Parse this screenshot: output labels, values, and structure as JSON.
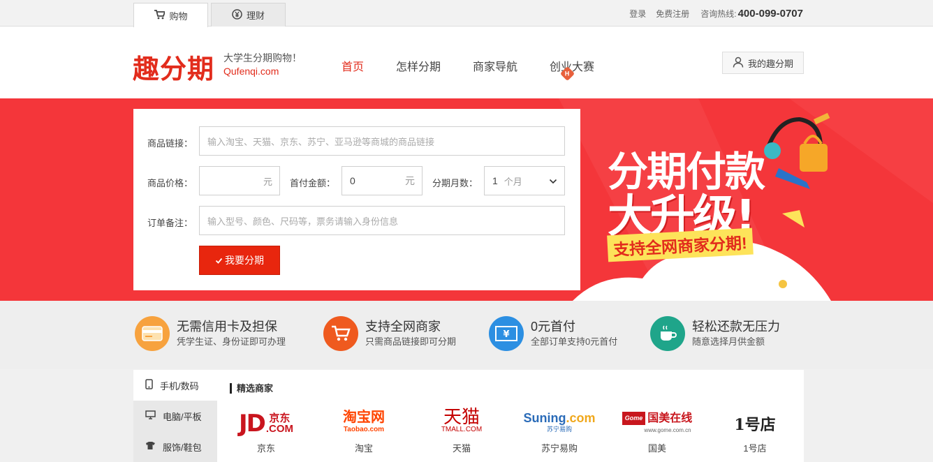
{
  "topbar": {
    "tabs": [
      {
        "label": "购物",
        "icon": "shopping-cart-icon",
        "active": true
      },
      {
        "label": "理财",
        "icon": "yen-coin-icon",
        "active": false
      }
    ],
    "login": "登录",
    "register": "免费注册",
    "hotline_label": "咨询热线:",
    "hotline_number": "400-099-0707"
  },
  "header": {
    "logo": "趣分期",
    "slogan": "大学生分期购物！",
    "slogan_en": "Qufenqi.com",
    "nav": [
      {
        "label": "首页",
        "active": true
      },
      {
        "label": "怎样分期",
        "active": false
      },
      {
        "label": "商家导航",
        "active": false
      },
      {
        "label": "创业大赛",
        "active": false,
        "badge": "H"
      }
    ],
    "my_account": "我的趣分期"
  },
  "form": {
    "link_label": "商品链接：",
    "link_placeholder": "输入淘宝、天猫、京东、苏宁、亚马逊等商城的商品链接",
    "price_label": "商品价格：",
    "price_unit": "元",
    "down_label": "首付金额：",
    "down_value": "0",
    "down_unit": "元",
    "months_label": "分期月数：",
    "months_value": "1",
    "months_unit": "个月",
    "note_label": "订单备注：",
    "note_placeholder": "输入型号、颜色、尺码等，票务请输入身份信息",
    "submit_label": "我要分期"
  },
  "promo": {
    "line1": "分期付款",
    "line2": "大升级!",
    "line3": "支持全网商家分期!"
  },
  "features": [
    {
      "title": "无需信用卡及担保",
      "sub": "凭学生证、身份证即可办理",
      "icon": "card-icon",
      "color": "#f7a23e"
    },
    {
      "title": "支持全网商家",
      "sub": "只需商品链接即可分期",
      "icon": "cart-icon",
      "color": "#ef5a1f"
    },
    {
      "title": "0元首付",
      "sub": "全部订单支持0元首付",
      "icon": "yen-bill-icon",
      "color": "#2c8fe2"
    },
    {
      "title": "轻松还款无压力",
      "sub": "随意选择月供金额",
      "icon": "coffee-cup-icon",
      "color": "#1fa58a"
    }
  ],
  "categories": [
    {
      "label": "手机/数码",
      "icon": "phone-icon"
    },
    {
      "label": "电脑/平板",
      "icon": "monitor-icon"
    },
    {
      "label": "服饰/鞋包",
      "icon": "shirt-icon"
    }
  ],
  "brands": {
    "title": "精选商家",
    "items": [
      {
        "logo_main": "JD",
        "logo_cn": "京东",
        "logo_sub": ".COM",
        "name": "京东",
        "color": "#c9151e"
      },
      {
        "logo_main": "淘宝网",
        "logo_sub": "Taobao.com",
        "name": "淘宝",
        "color": "#ff4400"
      },
      {
        "logo_main": "天猫",
        "logo_sub": "TMALL.COM",
        "name": "天猫",
        "color": "#c40000"
      },
      {
        "logo_main": "Suning",
        "logo_cn": ".com",
        "logo_sub": "苏宁易购",
        "name": "苏宁易购",
        "color": "#2a6bb8"
      },
      {
        "logo_main": "国美在线",
        "logo_badge": "Gome",
        "logo_sub": "www.gome.com.cn",
        "name": "国美",
        "color": "#c8161d"
      },
      {
        "logo_main": "1号店",
        "name": "1号店",
        "color": "#222222"
      }
    ]
  }
}
